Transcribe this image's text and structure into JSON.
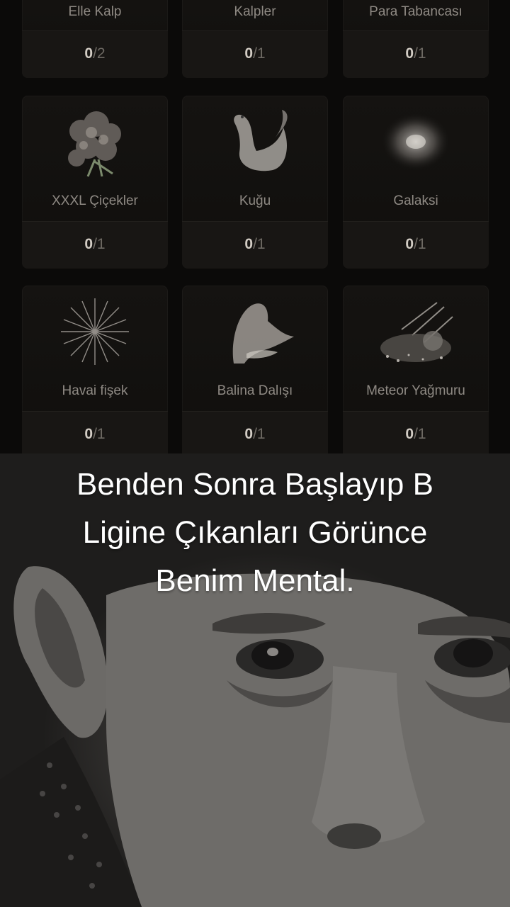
{
  "gift_grid": [
    {
      "name": "Elle Kalp",
      "count": "0",
      "total": "2"
    },
    {
      "name": "Kalpler",
      "count": "0",
      "total": "1"
    },
    {
      "name": "Para Tabancası",
      "count": "0",
      "total": "1"
    },
    {
      "name": "XXXL Çiçekler",
      "count": "0",
      "total": "1",
      "icon": "flowers-icon"
    },
    {
      "name": "Kuğu",
      "count": "0",
      "total": "1",
      "icon": "swan-icon"
    },
    {
      "name": "Galaksi",
      "count": "0",
      "total": "1",
      "icon": "galaxy-icon"
    },
    {
      "name": "Havai fişek",
      "count": "0",
      "total": "1",
      "icon": "fireworks-icon"
    },
    {
      "name": "Balina Dalışı",
      "count": "0",
      "total": "1",
      "icon": "whale-icon"
    },
    {
      "name": "Meteor Yağmuru",
      "count": "0",
      "total": "1",
      "icon": "meteor-icon"
    }
  ],
  "caption": {
    "line1": "Benden Sonra Başlayıp B",
    "line2": "Ligine Çıkanları Görünce",
    "line3": "Benim Mental."
  },
  "colors": {
    "panel_bg": "#0b0a09",
    "caption_text": "#ffffff",
    "photo_tone": "#5a5855"
  }
}
